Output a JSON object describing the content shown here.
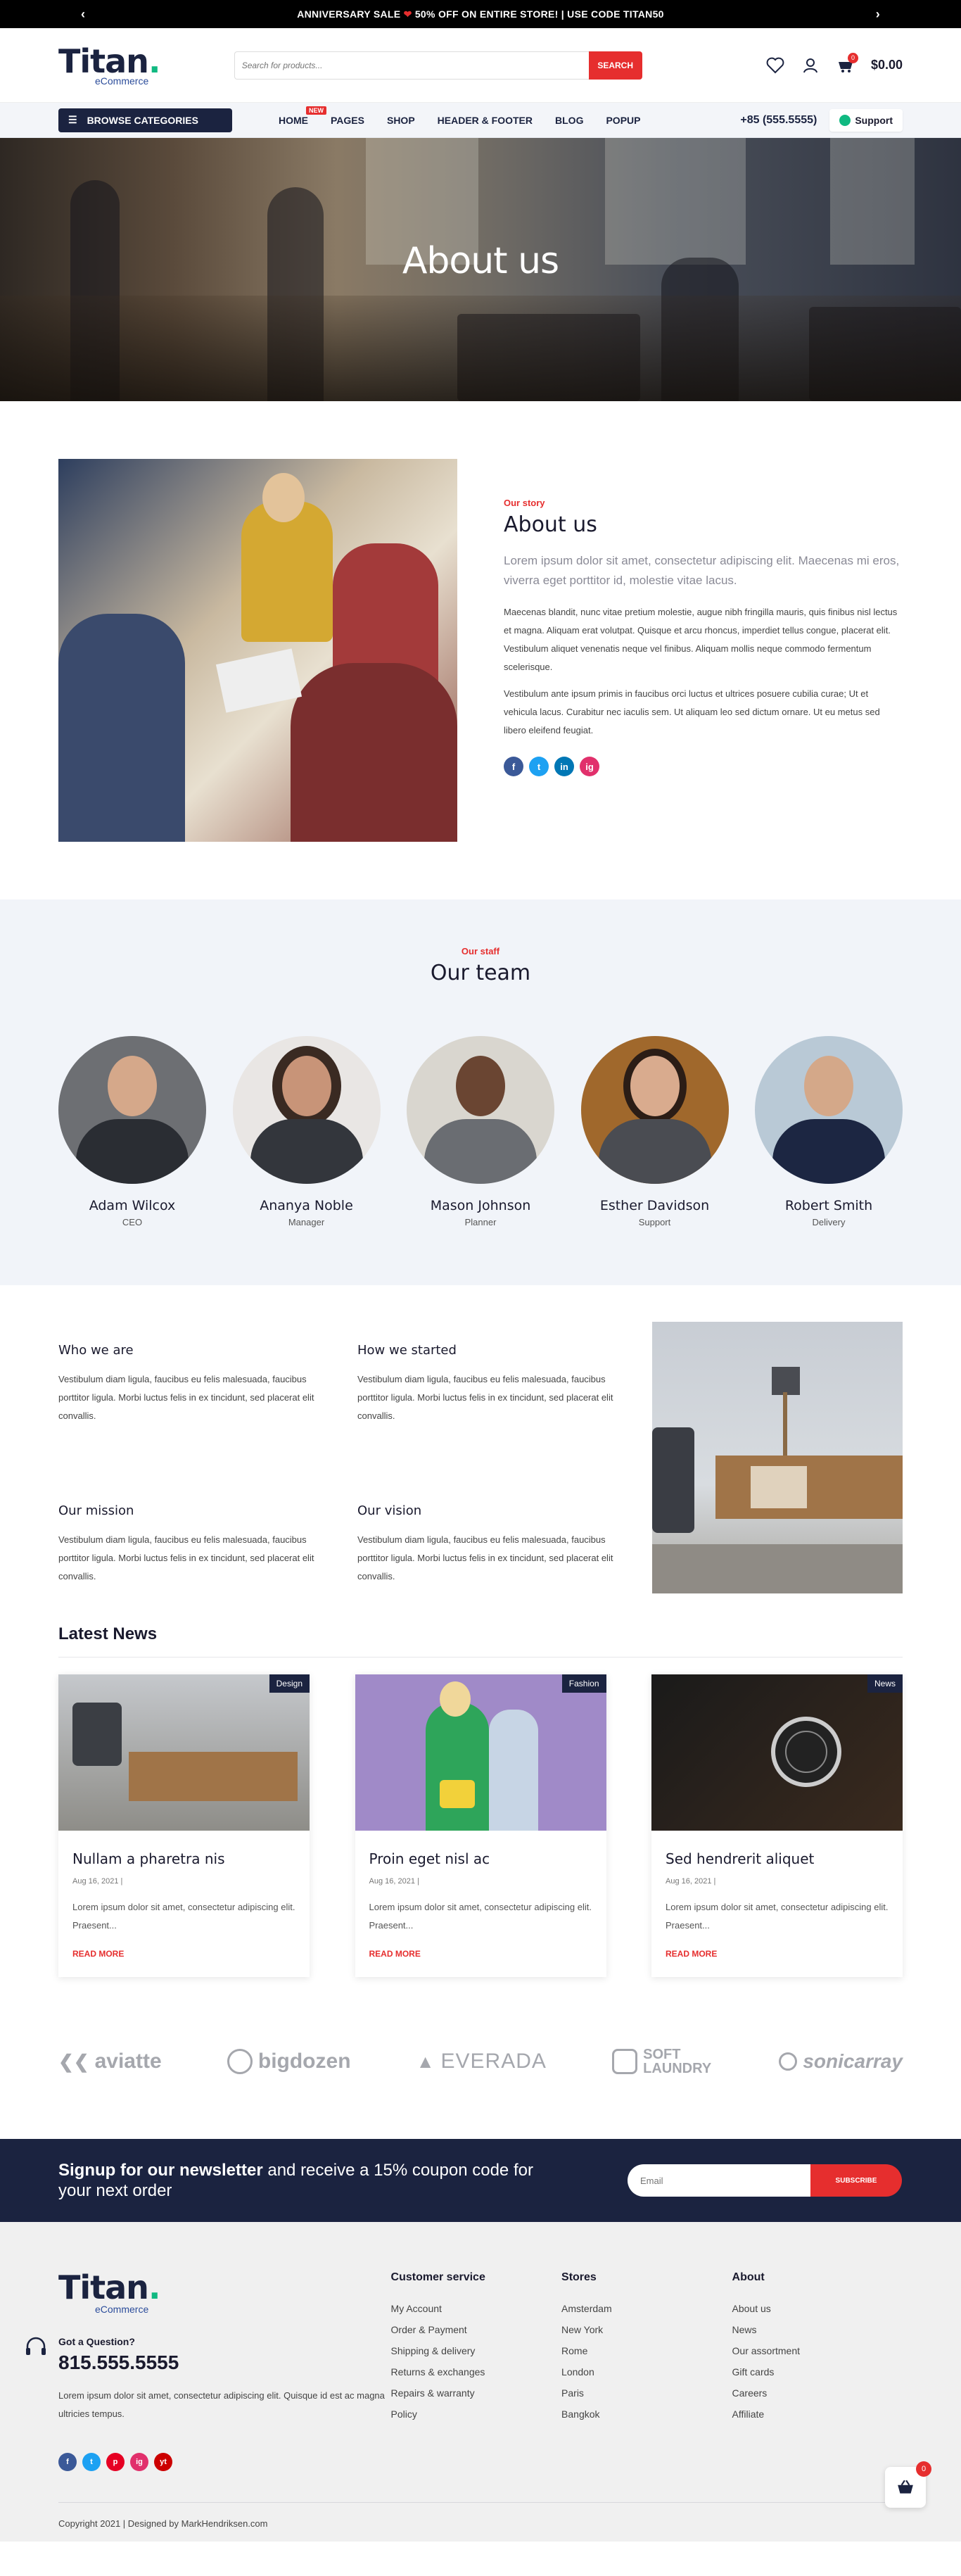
{
  "topbar": {
    "text_part1": "ANNIVERSARY SALE",
    "text_part2": "50% OFF ON ENTIRE STORE! | USE CODE TITAN50"
  },
  "header": {
    "logo": "Titan",
    "logo_dot": ".",
    "logo_sub": "eCommerce",
    "search_placeholder": "Search for products...",
    "search_button": "SEARCH",
    "cart_count": "0",
    "cart_total": "$0.00"
  },
  "nav": {
    "browse": "BROWSE CATEGORIES",
    "items": [
      "HOME",
      "PAGES",
      "SHOP",
      "HEADER & FOOTER",
      "BLOG",
      "POPUP"
    ],
    "new_tag": "NEW",
    "phone": "+85 (555.5555)",
    "support": "Support"
  },
  "hero": {
    "title": "About us"
  },
  "story": {
    "kicker": "Our story",
    "title": "About us",
    "lead": "Lorem ipsum dolor sit amet, consectetur adipiscing elit. Maecenas mi eros, viverra eget porttitor id, molestie vitae lacus.",
    "p1": "Maecenas blandit, nunc vitae pretium molestie, augue nibh fringilla mauris, quis finibus nisl lectus et magna. Aliquam erat volutpat. Quisque et arcu rhoncus, imperdiet tellus congue, placerat elit. Vestibulum aliquet venenatis neque vel finibus. Aliquam mollis neque commodo fermentum scelerisque.",
    "p2": "Vestibulum ante ipsum primis in faucibus orci luctus et ultrices posuere cubilia curae; Ut et vehicula lacus. Curabitur nec iaculis sem. Ut aliquam leo sed dictum ornare. Ut eu metus sed libero eleifend feugiat.",
    "social": [
      "f",
      "t",
      "in",
      "ig"
    ]
  },
  "team": {
    "kicker": "Our staff",
    "title": "Our team",
    "members": [
      {
        "name": "Adam Wilcox",
        "role": "CEO"
      },
      {
        "name": "Ananya Noble",
        "role": "Manager"
      },
      {
        "name": "Mason Johnson",
        "role": "Planner"
      },
      {
        "name": "Esther Davidson",
        "role": "Support"
      },
      {
        "name": "Robert Smith",
        "role": "Delivery"
      }
    ]
  },
  "info": {
    "blocks": [
      {
        "title": "Who we are",
        "text": "Vestibulum diam ligula, faucibus eu felis malesuada, faucibus porttitor ligula. Morbi luctus felis in ex tincidunt, sed placerat elit convallis."
      },
      {
        "title": "How we started",
        "text": "Vestibulum diam ligula, faucibus eu felis malesuada, faucibus porttitor ligula. Morbi luctus felis in ex tincidunt, sed placerat elit convallis."
      },
      {
        "title": "Our mission",
        "text": "Vestibulum diam ligula, faucibus eu felis malesuada, faucibus porttitor ligula. Morbi luctus felis in ex tincidunt, sed placerat elit convallis."
      },
      {
        "title": "Our vision",
        "text": "Vestibulum diam ligula, faucibus eu felis malesuada, faucibus porttitor ligula. Morbi luctus felis in ex tincidunt, sed placerat elit convallis."
      }
    ]
  },
  "news": {
    "title": "Latest News",
    "posts": [
      {
        "tag": "Design",
        "title": "Nullam a pharetra nis",
        "date": "Aug 16, 2021 |",
        "excerpt": "Lorem ipsum dolor sit amet, consectetur adipiscing elit. Praesent...",
        "more": "READ MORE"
      },
      {
        "tag": "Fashion",
        "title": "Proin eget nisl ac",
        "date": "Aug 16, 2021 |",
        "excerpt": "Lorem ipsum dolor sit amet, consectetur adipiscing elit. Praesent...",
        "more": "READ MORE"
      },
      {
        "tag": "News",
        "title": "Sed hendrerit aliquet",
        "date": "Aug 16, 2021 |",
        "excerpt": "Lorem ipsum dolor sit amet, consectetur adipiscing elit. Praesent...",
        "more": "READ MORE"
      }
    ]
  },
  "brands": [
    "aviatte",
    "bigdozen",
    "EVERADA",
    "SOFT LAUNDRY",
    "sonicarray"
  ],
  "newsletter": {
    "bold": "Signup for our newsletter",
    "rest": " and receive a 15% coupon code for your next order",
    "placeholder": "Email",
    "button": "SUBSCRIBE"
  },
  "footer": {
    "logo": "Titan",
    "logo_dot": ".",
    "logo_sub": "eCommerce",
    "question": "Got a Question?",
    "phone": "815.555.5555",
    "address": "Lorem ipsum dolor sit amet, consectetur adipiscing elit. Quisque id est ac magna ultricies tempus.",
    "social": [
      "f",
      "t",
      "p",
      "ig",
      "yt"
    ],
    "cols": [
      {
        "title": "Customer service",
        "links": [
          "My Account",
          "Order & Payment",
          "Shipping & delivery",
          "Returns & exchanges",
          "Repairs & warranty",
          "Policy"
        ]
      },
      {
        "title": "Stores",
        "links": [
          "Amsterdam",
          "New York",
          "Rome",
          "London",
          "Paris",
          "Bangkok"
        ]
      },
      {
        "title": "About",
        "links": [
          "About us",
          "News",
          "Our assortment",
          "Gift cards",
          "Careers",
          "Affiliate"
        ]
      }
    ],
    "copyright": "Copyright 2021 | Designed by MarkHendriksen.com",
    "mini_cart_count": "0"
  }
}
